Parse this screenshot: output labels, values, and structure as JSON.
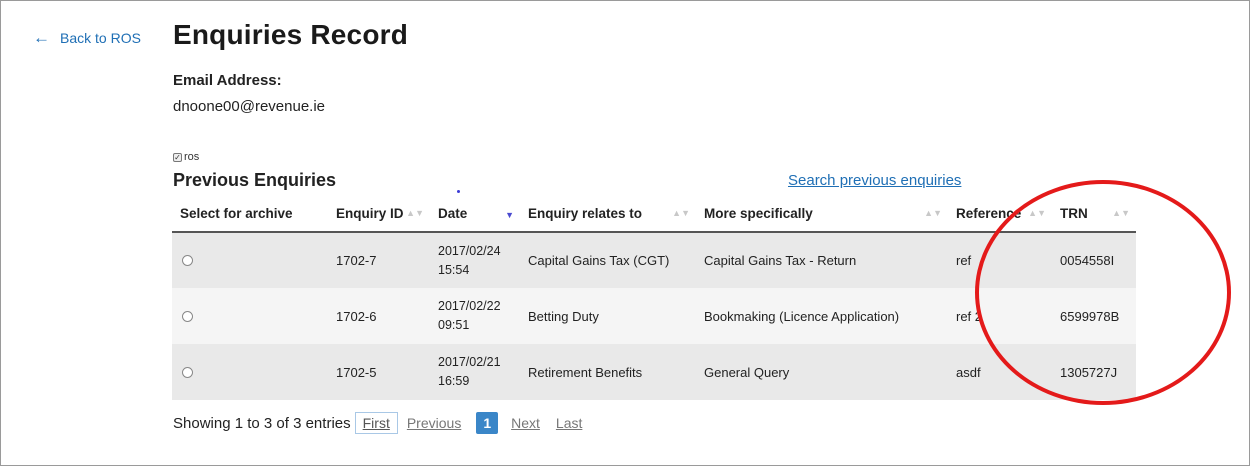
{
  "nav": {
    "back_label": "Back to ROS"
  },
  "page": {
    "title": "Enquiries Record"
  },
  "email": {
    "label": "Email Address:",
    "value": "dnoone00@revenue.ie"
  },
  "filter": {
    "ros_label": "ros",
    "ros_checked": true
  },
  "section": {
    "title": "Previous Enquiries",
    "search_link": "Search previous enquiries"
  },
  "table": {
    "headers": [
      "Select for archive",
      "Enquiry ID",
      "Date",
      "Enquiry relates to",
      "More specifically",
      "Reference",
      "TRN"
    ],
    "rows": [
      {
        "id": "1702-7",
        "date": "2017/02/24",
        "time": "15:54",
        "relates": "Capital Gains Tax (CGT)",
        "specific": "Capital Gains Tax - Return",
        "reference": "ref",
        "trn": "0054558I"
      },
      {
        "id": "1702-6",
        "date": "2017/02/22",
        "time": "09:51",
        "relates": "Betting Duty",
        "specific": "Bookmaking (Licence Application)",
        "reference": "ref 2",
        "trn": "6599978B"
      },
      {
        "id": "1702-5",
        "date": "2017/02/21",
        "time": "16:59",
        "relates": "Retirement Benefits",
        "specific": "General Query",
        "reference": "asdf",
        "trn": "1305727J"
      }
    ]
  },
  "pager": {
    "info": "Showing 1 to 3 of 3 entries",
    "first": "First",
    "previous": "Previous",
    "current": "1",
    "next": "Next",
    "last": "Last"
  },
  "colors": {
    "link": "#1f6fb5",
    "annotation": "#e41a1a",
    "active_page": "#3a86c8"
  }
}
